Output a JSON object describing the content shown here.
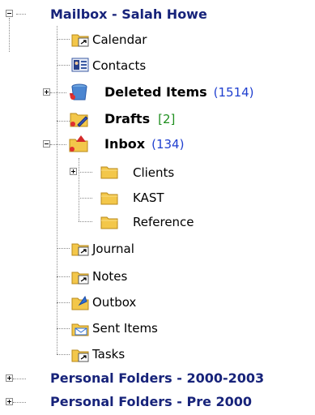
{
  "tree": {
    "mailbox": {
      "label": "Mailbox - Salah Howe",
      "items": [
        {
          "label": "Calendar",
          "icon": "calendar-folder-icon"
        },
        {
          "label": "Contacts",
          "icon": "contacts-icon"
        },
        {
          "label": "Deleted Items",
          "count": "(1514)",
          "icon": "deleted-items-icon"
        },
        {
          "label": "Drafts",
          "count": "[2]",
          "icon": "drafts-icon"
        },
        {
          "label": "Inbox",
          "count": "(134)",
          "icon": "inbox-icon",
          "children": [
            {
              "label": "Clients",
              "icon": "folder-icon"
            },
            {
              "label": "KAST",
              "icon": "folder-icon"
            },
            {
              "label": "Reference",
              "icon": "folder-icon"
            }
          ]
        },
        {
          "label": "Journal",
          "icon": "journal-folder-icon"
        },
        {
          "label": "Notes",
          "icon": "notes-folder-icon"
        },
        {
          "label": "Outbox",
          "icon": "outbox-icon"
        },
        {
          "label": "Sent Items",
          "icon": "sent-items-icon"
        },
        {
          "label": "Tasks",
          "icon": "tasks-folder-icon"
        }
      ]
    },
    "personal_folders": [
      {
        "label": "Personal Folders - 2000-2003"
      },
      {
        "label": "Personal Folders - Pre 2000"
      }
    ]
  },
  "colors": {
    "mailbox_text": "#17237a",
    "count_blue": "#1f3fcf",
    "count_green": "#1f8f1f",
    "tree_line": "#8a8a8a",
    "folder_yellow": "#f3c74a"
  }
}
